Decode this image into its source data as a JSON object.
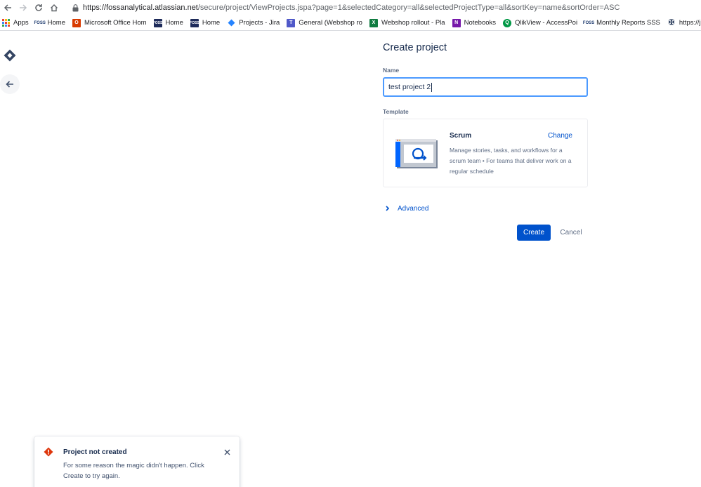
{
  "browser": {
    "url_host": "https://fossanalytical.atlassian.net",
    "url_rest": "/secure/project/ViewProjects.jspa?page=1&selectedCategory=all&selectedProjectType=all&sortKey=name&sortOrder=ASC",
    "bookmarks": [
      {
        "label": "Apps",
        "icon": "apps-grid-icon"
      },
      {
        "label": "Home",
        "icon": "foss-icon"
      },
      {
        "label": "Microsoft Office Hom",
        "icon": "office-icon"
      },
      {
        "label": "Home",
        "icon": "foss-dark-icon"
      },
      {
        "label": "Home",
        "icon": "foss-dark-icon"
      },
      {
        "label": "Projects - Jira",
        "icon": "jira-icon"
      },
      {
        "label": "General (Webshop ro",
        "icon": "teams-icon"
      },
      {
        "label": "Webshop rollout - Pla",
        "icon": "planner-icon"
      },
      {
        "label": "Notebooks",
        "icon": "onenote-icon"
      },
      {
        "label": "QlikView - AccessPoi",
        "icon": "qlik-icon"
      },
      {
        "label": "Monthly Reports SSS",
        "icon": "foss-icon"
      },
      {
        "label": "https://jira.valt",
        "icon": "valt-icon"
      }
    ]
  },
  "form": {
    "title": "Create project",
    "name_label": "Name",
    "name_value": "test project 2",
    "template_label": "Template",
    "template": {
      "name": "Scrum",
      "change_label": "Change",
      "description": "Manage stories, tasks, and workflows for a scrum team • For teams that deliver work on a regular schedule"
    },
    "advanced_label": "Advanced",
    "create_label": "Create",
    "cancel_label": "Cancel"
  },
  "flag": {
    "title": "Project not created",
    "body": "For some reason the magic didn't happen. Click Create to try again."
  },
  "colors": {
    "primary": "#0052cc",
    "error": "#de350b",
    "focus": "#4c9aff",
    "text": "#172b4d"
  }
}
